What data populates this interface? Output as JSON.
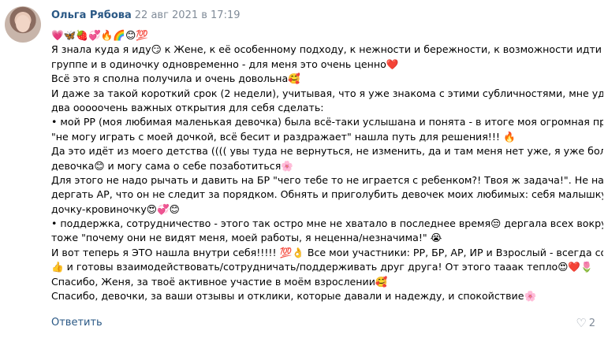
{
  "comment": {
    "author": "Ольга Рябова",
    "date": "22 авг 2021 в 17:19",
    "lines": [
      "💗🦋🍓💞🔥🌈😊💯",
      "Я знала куда я иду😏 к Жене, к её особенному подходу, к нежности и бережности, к возможности идти и в",
      "группе и в одиночку одновременно - для меня это очень ценно❤️",
      "Всё это я сполна получила и очень довольна🥰",
      "И даже за такой короткий срок (2 недели), учитывая, что я уже знакома с этими субличностями, мне удалось",
      "два ооооочень важных открытия для себя сделать:",
      "• мой РР (моя любимая маленькая девочка) была всё-таки услышана и понята - в итоге моя огромная проблема",
      "\"не могу играть с моей дочкой, всё бесит и раздражает\" нашла путь для решения!!! 🔥",
      "Да это идёт из моего детства (((( увы туда не вернуться, не изменить, да и там меня нет уже, я уже большая",
      "девочка😊 и могу сама о себе позаботиться🌸",
      "Для этого не надо рычать и давить на БР \"чего тебе то не играется с ребенком?! Твоя ж задача!\". Не надо",
      "дергать АР, что он не следит за порядком. Обнять и приголубить девочек моих любимых: себя малышку и",
      "дочку-кровиночку😍💞😊",
      "• поддержка, сотрудничество - этого так остро мне не хватало в последнее время😒 дергала всех вокруг и себя",
      "тоже \"почему они не видят меня, моей работы, я неценна/незначима!\" 😭",
      "И вот теперь я ЭТО нашла внутри себя!!!!! 💯👌 Все мои участники: РР, БР, АР, ИР и Взрослый - всегда со мной😉",
      "👍 и готовы взаимодействовать/сотрудничать/поддерживать друг друга! От этого тааак тепло😍❤️🌷",
      "Спасибо, Женя, за твоё активное участие в моём взрослении🥰",
      "Спасибо, девочки, за ваши отзывы и отклики, которые давали и надежду, и спокойствие🌸"
    ],
    "reply_label": "Ответить",
    "likes_count": "2",
    "like_icon": "heart-icon"
  },
  "colors": {
    "author": "#2a5885",
    "meta": "#818c99",
    "text": "#000000"
  }
}
